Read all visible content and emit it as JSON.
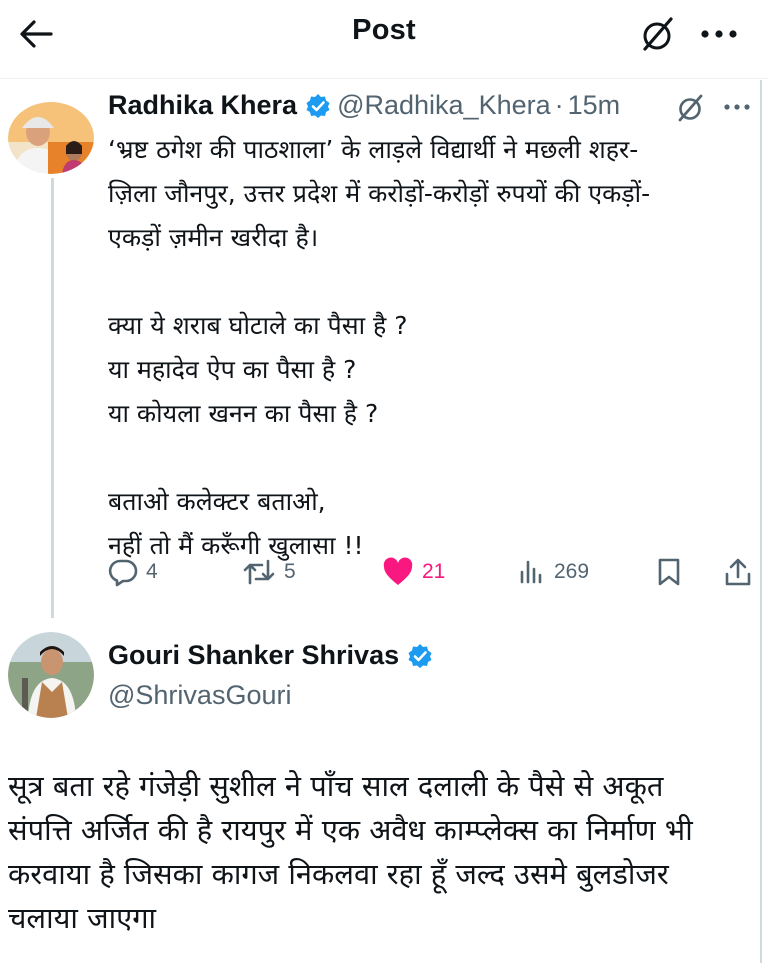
{
  "header": {
    "title": "Post",
    "back_icon": "arrow-left-icon",
    "grok_icon": "grok-icon",
    "more_icon": "more-horizontal-icon"
  },
  "tweet": {
    "author_name": "Radhika Khera",
    "handle": "@Radhika_Khera",
    "separator": "·",
    "time": "15m",
    "verified_color": "#1d9bf0",
    "lines": [
      "‘भ्रष्ट ठगेश की पाठशाला’ के लाड़ले विद्यार्थी ने मछली शहर-",
      "ज़िला जौनपुर, उत्तर प्रदेश में करोड़ों-करोड़ों रुपयों की एकड़ों-",
      "एकड़ों ज़मीन खरीदा है।",
      "",
      "क्या ये शराब घोटाले का पैसा है ?",
      "या महादेव ऐप का पैसा है ?",
      "या कोयला खनन का पैसा है ?",
      "",
      "बताओ कलेक्टर बताओ,",
      "नहीं तो मैं करूँगी खुलासा !!"
    ],
    "actions": {
      "replies": "4",
      "reposts": "5",
      "likes": "21",
      "views": "269"
    },
    "like_color": "#f91880"
  },
  "reply": {
    "author_name": "Gouri Shanker Shrivas",
    "handle": "@ShrivasGouri",
    "lines": [
      "सूत्र बता रहे गंजेड़ी सुशील ने पाँच साल दलाली के पैसे से अकूत",
      "संपत्ति अर्जित की है रायपुर में एक अवैध काम्प्लेक्स का निर्माण भी",
      "करवाया है जिसका कागज निकलवा रहा हूँ जल्द उसमे बुलडोजर",
      "चलाया जाएगा"
    ]
  }
}
